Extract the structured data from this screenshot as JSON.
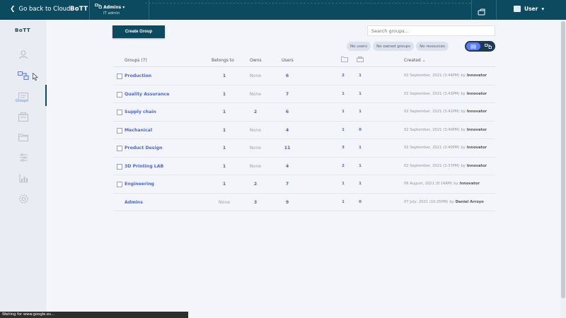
{
  "topbar": {
    "back_label": "Go back to Cloud",
    "brand": "BoTT",
    "role": "Admins",
    "role_sub": "IT admin",
    "user": "User"
  },
  "sidebar": {
    "logo": "BoTT",
    "items": [
      {
        "name": "user-icon"
      },
      {
        "name": "groups-icon",
        "label": "Groups",
        "active": true
      },
      {
        "name": "id-card-icon"
      },
      {
        "name": "printer-icon"
      },
      {
        "name": "folder-icon"
      },
      {
        "name": "sliders-icon"
      },
      {
        "name": "chart-icon"
      },
      {
        "name": "settings-icon"
      }
    ]
  },
  "toolbar": {
    "create_label": "Create Group",
    "search_placeholder": "Search groups...",
    "chips": [
      "No users",
      "No owned groups",
      "No resources"
    ]
  },
  "table": {
    "headers": {
      "groups": "Groups",
      "groups_count": "(7)",
      "belongs": "Belongs to",
      "owns": "Owns",
      "users": "Users",
      "created": "Created"
    },
    "rows": [
      {
        "name": "Production",
        "belongs": "1",
        "owns": "None",
        "users": "6",
        "folders": "2",
        "resources": "1",
        "created": "02 September, 2021 (3:44PM)",
        "by": "by",
        "creator": "Innovator",
        "checkbox": true
      },
      {
        "name": "Quality Assurance",
        "belongs": "1",
        "owns": "None",
        "users": "7",
        "folders": "1",
        "resources": "1",
        "created": "02 September, 2021 (3:43PM)",
        "by": "by",
        "creator": "Innovator",
        "checkbox": true
      },
      {
        "name": "Supply chain",
        "belongs": "1",
        "owns": "2",
        "users": "6",
        "folders": "1",
        "resources": "1",
        "created": "02 September, 2021 (3:41PM)",
        "by": "by",
        "creator": "Innovator",
        "checkbox": true
      },
      {
        "name": "Mechanical",
        "belongs": "1",
        "owns": "None",
        "users": "4",
        "folders": "1",
        "resources": "0",
        "created": "02 September, 2021 (3:40PM)",
        "by": "by",
        "creator": "Innovator",
        "checkbox": true
      },
      {
        "name": "Product Design",
        "belongs": "1",
        "owns": "None",
        "users": "11",
        "folders": "3",
        "resources": "1",
        "created": "02 September, 2021 (3:40PM)",
        "by": "by",
        "creator": "Innovator",
        "checkbox": true
      },
      {
        "name": "3D Printing LAB",
        "belongs": "1",
        "owns": "None",
        "users": "4",
        "folders": "2",
        "resources": "1",
        "created": "02 September, 2021 (3:37PM)",
        "by": "by",
        "creator": "Innovator",
        "checkbox": true
      },
      {
        "name": "Engineering",
        "belongs": "1",
        "owns": "2",
        "users": "7",
        "folders": "1",
        "resources": "1",
        "created": "06 August, 2021 (8:14AM)",
        "by": "by",
        "creator": "Innovator",
        "checkbox": true
      },
      {
        "name": "Admins",
        "belongs": "None",
        "owns": "3",
        "users": "9",
        "folders": "1",
        "resources": "0",
        "created": "07 July, 2021 (10:25PM)",
        "by": "by",
        "creator": "Daniel Arroyo",
        "checkbox": false
      }
    ]
  },
  "status_bar": "Waiting for www.google.es...",
  "colors": {
    "primary": "#0c4a60",
    "accent": "#4968d8",
    "background": "#f4f5fa"
  }
}
